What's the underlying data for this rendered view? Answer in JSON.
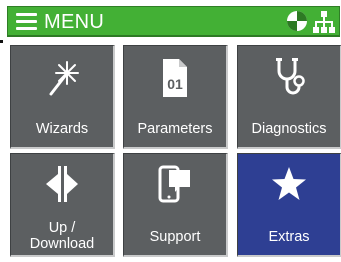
{
  "header": {
    "title": "MENU",
    "menu_icon": "hamburger-menu-icon",
    "status_icon": "device-status-icon",
    "network_icon": "network-tree-icon",
    "color": "#43b035"
  },
  "tiles": [
    {
      "label": "Wizards",
      "icon": "magic-wand-icon"
    },
    {
      "label": "Parameters",
      "icon": "parameters-document-icon",
      "icon_text": "01"
    },
    {
      "label": "Diagnostics",
      "icon": "stethoscope-icon"
    },
    {
      "label_line1": "Up /",
      "label_line2": "Download",
      "icon": "up-download-arrows-icon"
    },
    {
      "label": "Support",
      "icon": "support-device-chat-icon"
    },
    {
      "label": "Extras",
      "icon": "star-icon"
    }
  ],
  "colors": {
    "tile": "#5c5f61",
    "tile_highlight": "#2e3f93",
    "header": "#43b035"
  }
}
